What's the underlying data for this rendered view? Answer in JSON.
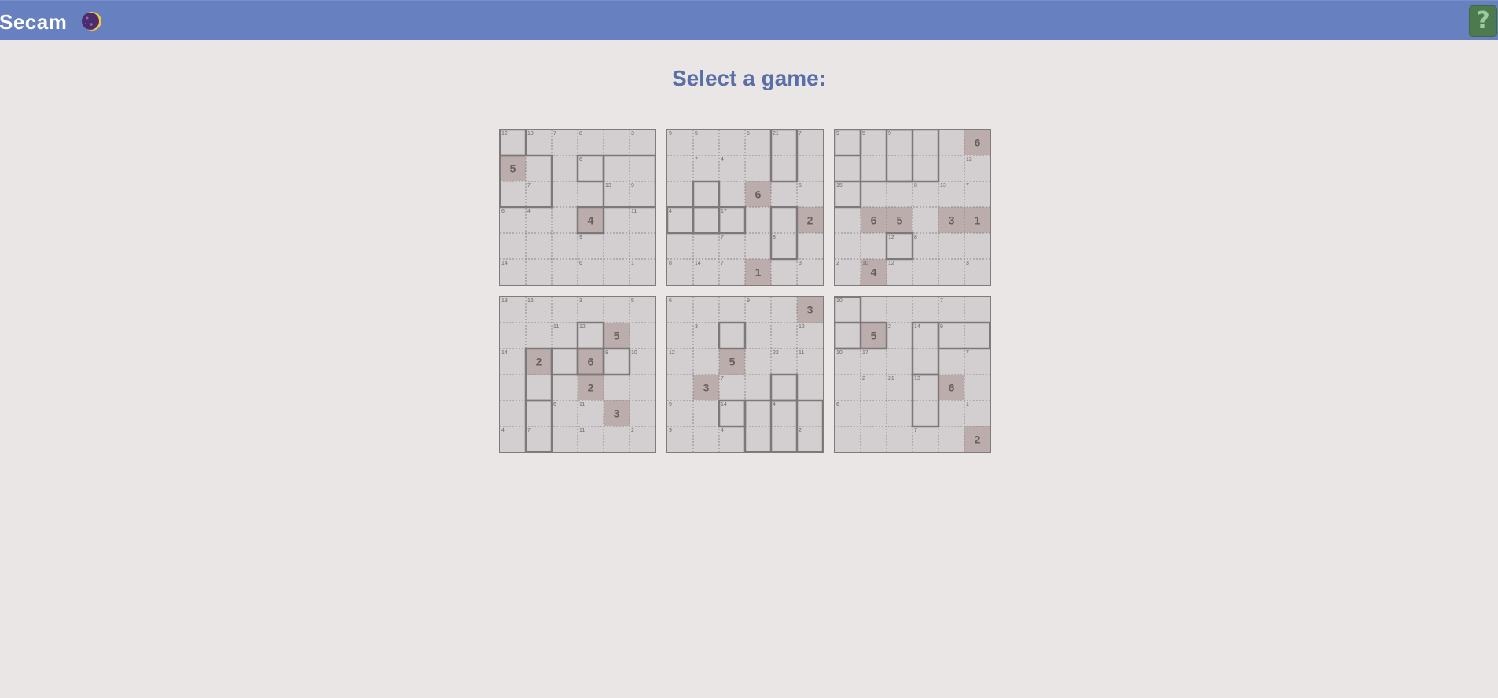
{
  "header": {
    "title": "Secam"
  },
  "page": {
    "heading": "Select a game:"
  },
  "colors": {
    "topbar": "#6680c0",
    "heading": "#5a6fa8",
    "cell": "#d3cfd1",
    "given_cell": "#bcadad",
    "help_button": "#4d7a4f"
  },
  "icons": {
    "theme_toggle": "moon-icon",
    "help": "question-icon"
  },
  "help_label": "?",
  "puzzles": [
    {
      "givens": [
        [
          1,
          0,
          "5"
        ],
        [
          3,
          3,
          "4"
        ]
      ],
      "cages": [
        [
          0,
          0,
          "12"
        ],
        [
          0,
          1,
          "10"
        ],
        [
          0,
          2,
          "7"
        ],
        [
          0,
          3,
          "8"
        ],
        [
          0,
          5,
          "3"
        ],
        [
          1,
          3,
          "6"
        ],
        [
          2,
          1,
          "7"
        ],
        [
          2,
          4,
          "13"
        ],
        [
          2,
          5,
          "9"
        ],
        [
          3,
          0,
          "6"
        ],
        [
          3,
          1,
          "4"
        ],
        [
          3,
          5,
          "11"
        ],
        [
          4,
          3,
          "9"
        ],
        [
          5,
          0,
          "14"
        ],
        [
          5,
          3,
          "6"
        ],
        [
          5,
          5,
          "1"
        ]
      ]
    },
    {
      "givens": [
        [
          2,
          3,
          "6"
        ],
        [
          3,
          5,
          "2"
        ],
        [
          5,
          3,
          "1"
        ]
      ],
      "cages": [
        [
          0,
          0,
          "9"
        ],
        [
          0,
          1,
          "5"
        ],
        [
          0,
          3,
          "5"
        ],
        [
          0,
          4,
          "21"
        ],
        [
          0,
          5,
          "7"
        ],
        [
          1,
          1,
          "7"
        ],
        [
          1,
          2,
          "4"
        ],
        [
          2,
          5,
          "5"
        ],
        [
          3,
          0,
          "4"
        ],
        [
          3,
          2,
          "17"
        ],
        [
          4,
          2,
          "7"
        ],
        [
          4,
          4,
          "8"
        ],
        [
          5,
          0,
          "8"
        ],
        [
          5,
          1,
          "14"
        ],
        [
          5,
          2,
          "7"
        ],
        [
          5,
          5,
          "3"
        ]
      ]
    },
    {
      "givens": [
        [
          0,
          5,
          "6"
        ],
        [
          3,
          1,
          "6"
        ],
        [
          3,
          2,
          "5"
        ],
        [
          3,
          4,
          "3"
        ],
        [
          3,
          5,
          "1"
        ],
        [
          5,
          1,
          "4"
        ]
      ],
      "cages": [
        [
          0,
          0,
          "9"
        ],
        [
          0,
          1,
          "5"
        ],
        [
          0,
          2,
          "9"
        ],
        [
          1,
          5,
          "12"
        ],
        [
          2,
          0,
          "15"
        ],
        [
          2,
          3,
          "8"
        ],
        [
          2,
          4,
          "13"
        ],
        [
          2,
          5,
          "7"
        ],
        [
          4,
          2,
          "12"
        ],
        [
          4,
          3,
          "8"
        ],
        [
          5,
          0,
          "2"
        ],
        [
          5,
          1,
          "10"
        ],
        [
          5,
          2,
          "12"
        ],
        [
          5,
          5,
          "3"
        ]
      ]
    },
    {
      "givens": [
        [
          1,
          4,
          "5"
        ],
        [
          2,
          1,
          "2"
        ],
        [
          2,
          3,
          "6"
        ],
        [
          3,
          3,
          "2"
        ],
        [
          4,
          4,
          "3"
        ]
      ],
      "cages": [
        [
          0,
          0,
          "13"
        ],
        [
          0,
          1,
          "16"
        ],
        [
          0,
          3,
          "3"
        ],
        [
          0,
          5,
          "5"
        ],
        [
          1,
          2,
          "11"
        ],
        [
          1,
          3,
          "12"
        ],
        [
          2,
          0,
          "14"
        ],
        [
          2,
          4,
          "8"
        ],
        [
          2,
          5,
          "10"
        ],
        [
          4,
          2,
          "6"
        ],
        [
          4,
          3,
          "11"
        ],
        [
          5,
          0,
          "4"
        ],
        [
          5,
          1,
          "7"
        ],
        [
          5,
          3,
          "11"
        ],
        [
          5,
          5,
          "2"
        ]
      ]
    },
    {
      "givens": [
        [
          0,
          5,
          "3"
        ],
        [
          2,
          2,
          "5"
        ],
        [
          3,
          1,
          "3"
        ]
      ],
      "cages": [
        [
          0,
          0,
          "6"
        ],
        [
          0,
          3,
          "9"
        ],
        [
          1,
          1,
          "3"
        ],
        [
          1,
          5,
          "12"
        ],
        [
          2,
          0,
          "12"
        ],
        [
          2,
          4,
          "22"
        ],
        [
          2,
          5,
          "11"
        ],
        [
          3,
          2,
          "7"
        ],
        [
          4,
          0,
          "9"
        ],
        [
          4,
          2,
          "14"
        ],
        [
          4,
          4,
          "4"
        ],
        [
          5,
          0,
          "9"
        ],
        [
          5,
          2,
          "4"
        ],
        [
          5,
          5,
          "2"
        ]
      ]
    },
    {
      "givens": [
        [
          1,
          1,
          "5"
        ],
        [
          3,
          4,
          "6"
        ],
        [
          5,
          5,
          "2"
        ]
      ],
      "cages": [
        [
          0,
          0,
          "10"
        ],
        [
          0,
          4,
          "7"
        ],
        [
          1,
          2,
          "2"
        ],
        [
          1,
          3,
          "14"
        ],
        [
          1,
          4,
          "9"
        ],
        [
          2,
          0,
          "10"
        ],
        [
          2,
          1,
          "17"
        ],
        [
          2,
          5,
          "7"
        ],
        [
          3,
          1,
          "2"
        ],
        [
          3,
          2,
          "21"
        ],
        [
          3,
          3,
          "13"
        ],
        [
          4,
          0,
          "6"
        ],
        [
          4,
          5,
          "1"
        ],
        [
          5,
          3,
          "7"
        ]
      ]
    }
  ]
}
